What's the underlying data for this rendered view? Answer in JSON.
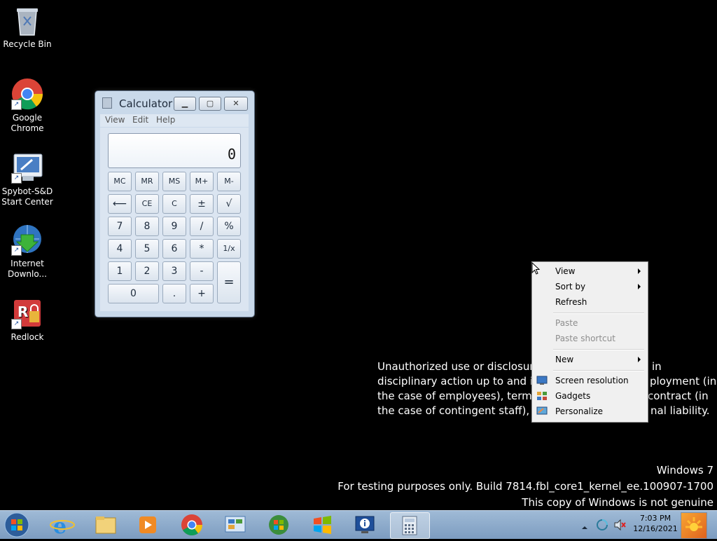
{
  "desktop": {
    "icons": [
      {
        "label": "Recycle Bin"
      },
      {
        "label_line1": "Google",
        "label_line2": "Chrome"
      },
      {
        "label_line1": "Spybot-S&D",
        "label_line2": "Start Center"
      },
      {
        "label_line1": "Internet",
        "label_line2": "Downlo..."
      },
      {
        "label": "Redlock"
      }
    ]
  },
  "calculator": {
    "title": "Calculator",
    "menu": [
      "View",
      "Edit",
      "Help"
    ],
    "display": "0",
    "keys": {
      "mc": "MC",
      "mr": "MR",
      "ms": "MS",
      "mplus": "M+",
      "mminus": "M-",
      "back": "⟵",
      "ce": "CE",
      "c": "C",
      "plusminus": "±",
      "sqrt": "√",
      "seven": "7",
      "eight": "8",
      "nine": "9",
      "divide": "/",
      "percent": "%",
      "four": "4",
      "five": "5",
      "six": "6",
      "multiply": "*",
      "reciprocal": "1/x",
      "one": "1",
      "two": "2",
      "three": "3",
      "minus": "-",
      "equals": "=",
      "zero": "0",
      "decimal": ".",
      "plus": "+"
    }
  },
  "context_menu": {
    "view": "View",
    "sort_by": "Sort by",
    "refresh": "Refresh",
    "paste": "Paste",
    "paste_shortcut": "Paste shortcut",
    "new": "New",
    "screen_resolution": "Screen resolution",
    "gadgets": "Gadgets",
    "personalize": "Personalize"
  },
  "warning_text": {
    "line1_a": "Unauthorized use or disclosure i",
    "line1_b": "in",
    "line2_a": "disciplinary action up to and inc",
    "line2_b": "ployment (in",
    "line3_a": "the case of employees), terminat",
    "line3_b": "contract (in",
    "line4_a": "the case of contingent staff), and",
    "line4_b": "nal liability."
  },
  "watermark": {
    "line1": "Windows 7",
    "line2": "For testing purposes only. Build 7814.fbl_core1_kernel_ee.100907-1700",
    "line3": "This copy of Windows is not genuine"
  },
  "taskbar": {
    "time": "7:03 PM",
    "date": "12/16/2021"
  }
}
